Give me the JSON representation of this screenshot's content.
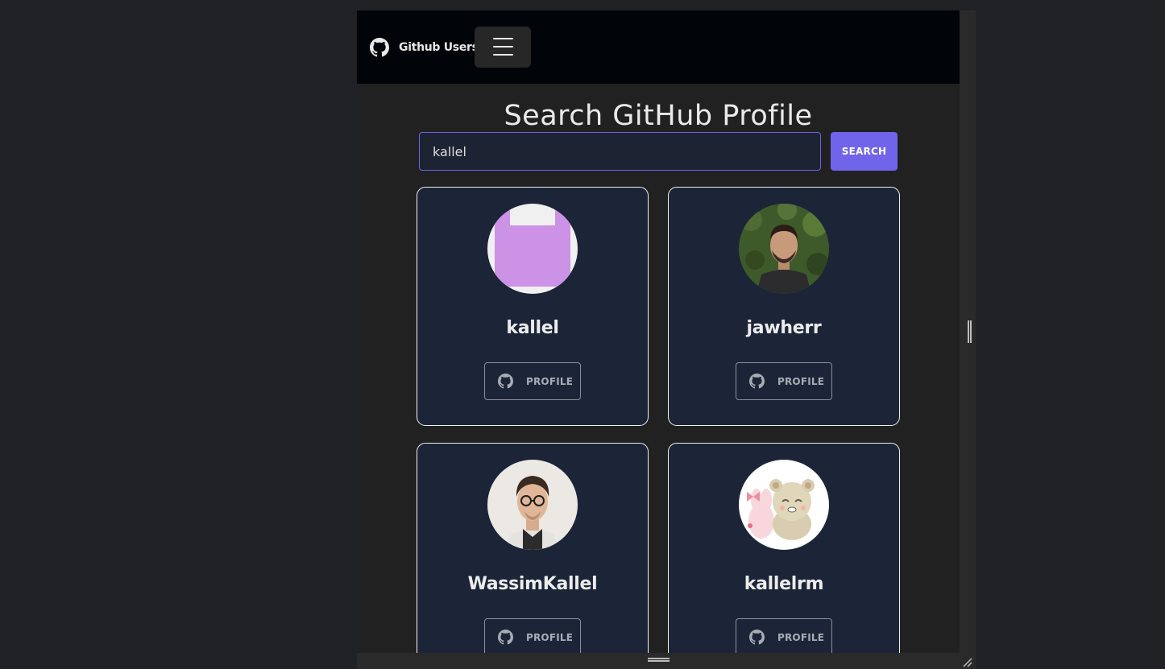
{
  "navbar": {
    "brand_icon": "github-icon",
    "brand_text": "Github Users",
    "menu_icon": "hamburger-menu-icon"
  },
  "main": {
    "title": "Search GitHub Profile",
    "search": {
      "value": "kallel",
      "button_label": "SEARCH"
    }
  },
  "users": [
    {
      "username": "kallel",
      "avatar": "identicon",
      "profile_label": "PROFILE",
      "profile_icon": "github-icon"
    },
    {
      "username": "jawherr",
      "avatar": "photo-man-outdoor",
      "profile_label": "PROFILE",
      "profile_icon": "github-icon"
    },
    {
      "username": "WassimKallel",
      "avatar": "photo-man-glasses",
      "profile_label": "PROFILE",
      "profile_icon": "github-icon"
    },
    {
      "username": "kallelrm",
      "avatar": "cartoon-bears",
      "profile_label": "PROFILE",
      "profile_icon": "github-icon"
    }
  ],
  "colors": {
    "navbar_bg": "#010409",
    "page_bg": "#212121",
    "card_bg": "#1c2538",
    "accent": "#7064ea",
    "identicon": "#cc92e6"
  }
}
